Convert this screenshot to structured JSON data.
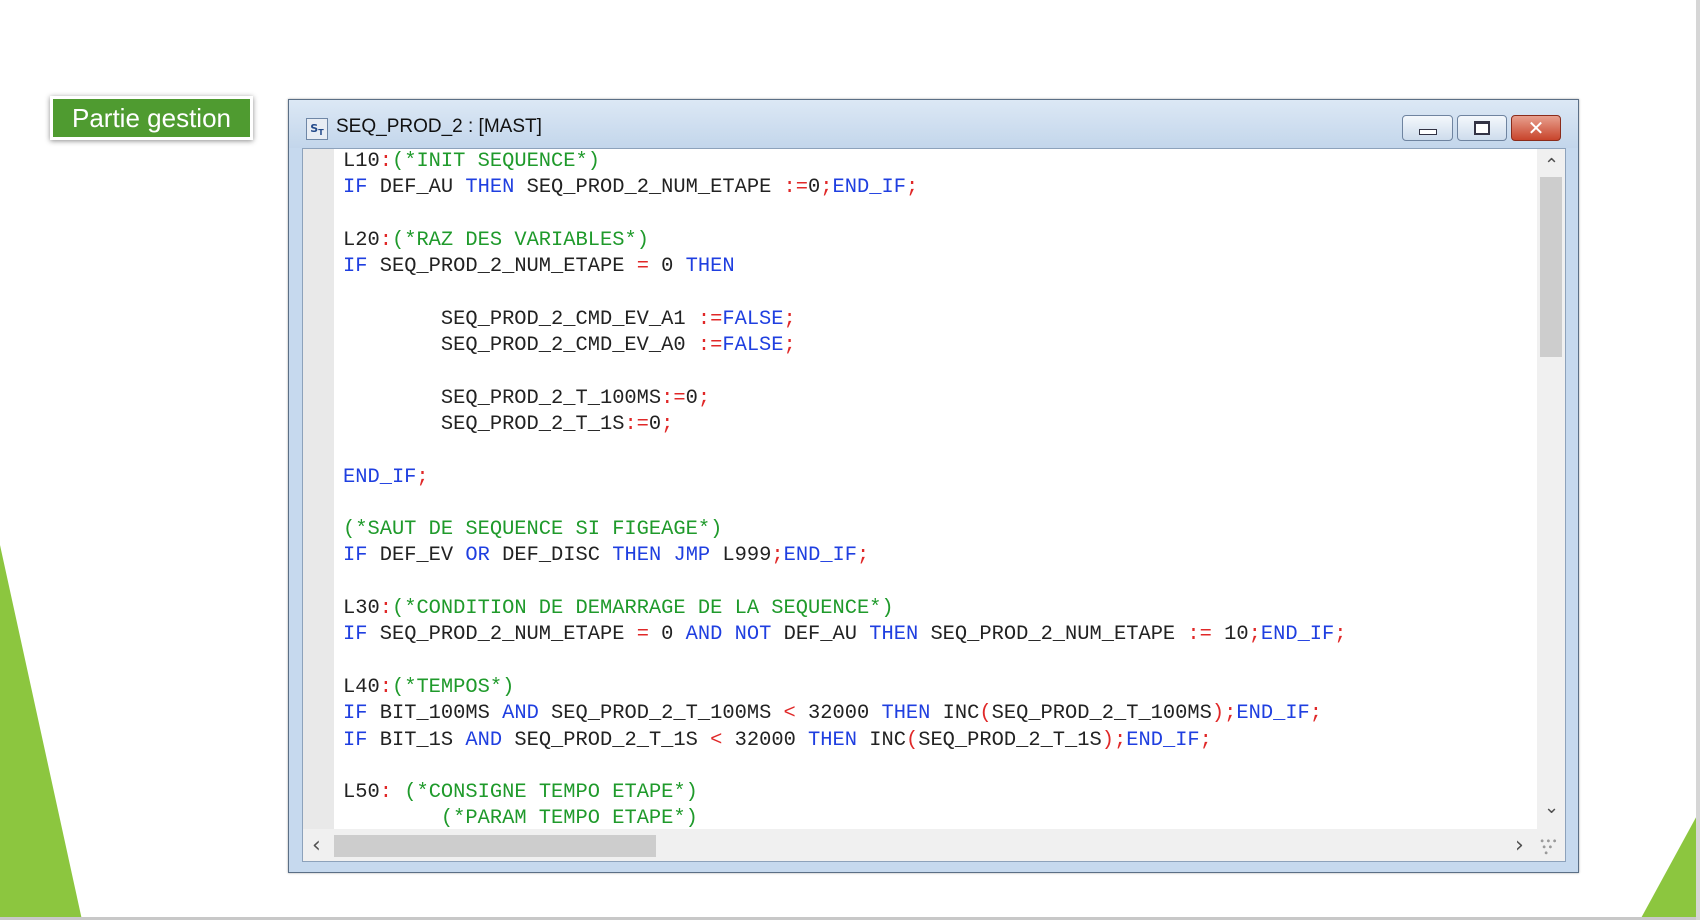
{
  "slide": {
    "section_label": "Partie gestion",
    "accent_color": "#4f9b30"
  },
  "window": {
    "title": "SEQ_PROD_2 : [MAST]",
    "icon": "st-editor-icon",
    "controls": [
      "minimize-icon",
      "maximize-icon",
      "close-icon"
    ],
    "close_glyph": "✕"
  },
  "colors": {
    "keyword": "#1f3fe0",
    "operator": "#e02828",
    "comment": "#1f9a2b",
    "text": "#222222"
  },
  "scrollbars": {
    "up_arrow": "⌃",
    "down_arrow": "⌄",
    "left_arrow": "‹",
    "right_arrow": "›"
  },
  "code_lines": [
    [
      [
        "tx",
        "L10"
      ],
      [
        "op",
        ":"
      ],
      [
        "cm",
        "(*INIT SEQUENCE*)"
      ]
    ],
    [
      [
        "kw",
        "IF"
      ],
      [
        "tx",
        " DEF_AU "
      ],
      [
        "kw",
        "THEN"
      ],
      [
        "tx",
        " SEQ_PROD_2_NUM_ETAPE "
      ],
      [
        "op",
        ":="
      ],
      [
        "tx",
        "0"
      ],
      [
        "op",
        ";"
      ],
      [
        "kw",
        "END_IF"
      ],
      [
        "op",
        ";"
      ]
    ],
    [],
    [
      [
        "tx",
        "L20"
      ],
      [
        "op",
        ":"
      ],
      [
        "cm",
        "(*RAZ DES VARIABLES*)"
      ]
    ],
    [
      [
        "kw",
        "IF"
      ],
      [
        "tx",
        " SEQ_PROD_2_NUM_ETAPE "
      ],
      [
        "op",
        "="
      ],
      [
        "tx",
        " 0 "
      ],
      [
        "kw",
        "THEN"
      ]
    ],
    [],
    [
      [
        "tx",
        "        SEQ_PROD_2_CMD_EV_A1 "
      ],
      [
        "op",
        ":="
      ],
      [
        "kw",
        "FALSE"
      ],
      [
        "op",
        ";"
      ]
    ],
    [
      [
        "tx",
        "        SEQ_PROD_2_CMD_EV_A0 "
      ],
      [
        "op",
        ":="
      ],
      [
        "kw",
        "FALSE"
      ],
      [
        "op",
        ";"
      ]
    ],
    [],
    [
      [
        "tx",
        "        SEQ_PROD_2_T_100MS"
      ],
      [
        "op",
        ":="
      ],
      [
        "tx",
        "0"
      ],
      [
        "op",
        ";"
      ]
    ],
    [
      [
        "tx",
        "        SEQ_PROD_2_T_1S"
      ],
      [
        "op",
        ":="
      ],
      [
        "tx",
        "0"
      ],
      [
        "op",
        ";"
      ]
    ],
    [],
    [
      [
        "kw",
        "END_IF"
      ],
      [
        "op",
        ";"
      ]
    ],
    [],
    [
      [
        "cm",
        "(*SAUT DE SEQUENCE SI FIGEAGE*)"
      ]
    ],
    [
      [
        "kw",
        "IF"
      ],
      [
        "tx",
        " DEF_EV "
      ],
      [
        "kw",
        "OR"
      ],
      [
        "tx",
        " DEF_DISC "
      ],
      [
        "kw",
        "THEN"
      ],
      [
        "tx",
        " "
      ],
      [
        "kw",
        "JMP"
      ],
      [
        "tx",
        " L999"
      ],
      [
        "op",
        ";"
      ],
      [
        "kw",
        "END_IF"
      ],
      [
        "op",
        ";"
      ]
    ],
    [],
    [
      [
        "tx",
        "L30"
      ],
      [
        "op",
        ":"
      ],
      [
        "cm",
        "(*CONDITION DE DEMARRAGE DE LA SEQUENCE*)"
      ]
    ],
    [
      [
        "kw",
        "IF"
      ],
      [
        "tx",
        " SEQ_PROD_2_NUM_ETAPE "
      ],
      [
        "op",
        "="
      ],
      [
        "tx",
        " 0 "
      ],
      [
        "kw",
        "AND"
      ],
      [
        "tx",
        " "
      ],
      [
        "kw",
        "NOT"
      ],
      [
        "tx",
        " DEF_AU "
      ],
      [
        "kw",
        "THEN"
      ],
      [
        "tx",
        " SEQ_PROD_2_NUM_ETAPE "
      ],
      [
        "op",
        ":="
      ],
      [
        "tx",
        " 10"
      ],
      [
        "op",
        ";"
      ],
      [
        "kw",
        "END_IF"
      ],
      [
        "op",
        ";"
      ]
    ],
    [],
    [
      [
        "tx",
        "L40"
      ],
      [
        "op",
        ":"
      ],
      [
        "cm",
        "(*TEMPOS*)"
      ]
    ],
    [
      [
        "kw",
        "IF"
      ],
      [
        "tx",
        " BIT_100MS "
      ],
      [
        "kw",
        "AND"
      ],
      [
        "tx",
        " SEQ_PROD_2_T_100MS "
      ],
      [
        "op",
        "<"
      ],
      [
        "tx",
        " 32000 "
      ],
      [
        "kw",
        "THEN"
      ],
      [
        "tx",
        " INC"
      ],
      [
        "op",
        "("
      ],
      [
        "tx",
        "SEQ_PROD_2_T_100MS"
      ],
      [
        "op",
        ")"
      ],
      [
        "op",
        ";"
      ],
      [
        "kw",
        "END_IF"
      ],
      [
        "op",
        ";"
      ]
    ],
    [
      [
        "kw",
        "IF"
      ],
      [
        "tx",
        " BIT_1S "
      ],
      [
        "kw",
        "AND"
      ],
      [
        "tx",
        " SEQ_PROD_2_T_1S "
      ],
      [
        "op",
        "<"
      ],
      [
        "tx",
        " 32000 "
      ],
      [
        "kw",
        "THEN"
      ],
      [
        "tx",
        " INC"
      ],
      [
        "op",
        "("
      ],
      [
        "tx",
        "SEQ_PROD_2_T_1S"
      ],
      [
        "op",
        ")"
      ],
      [
        "op",
        ";"
      ],
      [
        "kw",
        "END_IF"
      ],
      [
        "op",
        ";"
      ]
    ],
    [],
    [
      [
        "tx",
        "L50"
      ],
      [
        "op",
        ":"
      ],
      [
        "tx",
        " "
      ],
      [
        "cm",
        "(*CONSIGNE TEMPO ETAPE*)"
      ]
    ],
    [
      [
        "tx",
        "        "
      ],
      [
        "cm",
        "(*PARAM TEMPO ETAPE*)"
      ]
    ]
  ]
}
